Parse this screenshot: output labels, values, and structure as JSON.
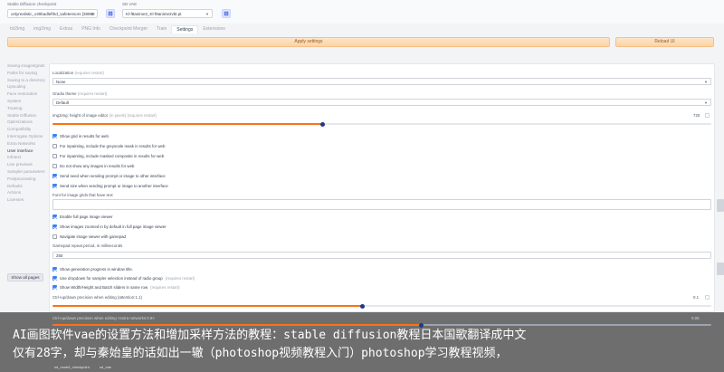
{
  "topbar": {
    "checkpoint_label": "Stable Diffusion checkpoint",
    "checkpoint_value": "onlyrealistic_v30badlefthd_safetensors [39958",
    "clip_label": "SD VAE",
    "clip_value": "Kl-f8anime2_Kl-f8anime2vbt.pt"
  },
  "tabs": [
    "txt2img",
    "img2img",
    "Extras",
    "PNG Info",
    "Checkpoint Merger",
    "Train",
    "Settings",
    "Extensions"
  ],
  "buttons": {
    "apply": "Apply settings",
    "reload": "Reload UI",
    "show_all": "Show all pages"
  },
  "sidebar": [
    "Saving images/grids",
    "Paths for saving",
    "Saving to a directory",
    "Upscaling",
    "Face restoration",
    "System",
    "Training",
    "Stable Diffusion",
    "Optimizations",
    "Compatibility",
    "Interrogate Options",
    "Extra Networks",
    "User interface",
    "Infotext",
    "Live previews",
    "Sampler parameters",
    "Postprocessing",
    "Defaults",
    "Actions",
    "Licenses"
  ],
  "sidebar_active_index": 12,
  "settings": {
    "localization_label": "Localization",
    "localization_note": "(requires restart)",
    "localization_value": "None",
    "gradio_label": "Gradio theme",
    "gradio_note": "(requires restart)",
    "gradio_value": "Default",
    "img_height_label": "img2img: height of image editor",
    "img_height_note": "(in pixels) (requires restart)",
    "img_height_value": "720",
    "img_height_fraction": 0.41,
    "checks1": [
      {
        "text": "Show grid in results for web",
        "note": "",
        "on": true
      },
      {
        "text": "For inpainting, include the greyscale mask in results for web",
        "note": "",
        "on": false
      },
      {
        "text": "For inpainting, include masked composite in results for web",
        "note": "",
        "on": false
      },
      {
        "text": "Do not show any images in results for web",
        "note": "",
        "on": false
      },
      {
        "text": "Send seed when sending prompt or image to other interface",
        "note": "",
        "on": true
      },
      {
        "text": "Send size when sending prompt or image to another interface",
        "note": "",
        "on": true
      }
    ],
    "font_label": "Font for image grids that have text",
    "checks2": [
      {
        "text": "Enable full page image viewer",
        "note": "",
        "on": true
      },
      {
        "text": "Show images zoomed in by default in full page image viewer",
        "note": "",
        "on": true
      },
      {
        "text": "Navigate image viewer with gamepad",
        "note": "",
        "on": false
      }
    ],
    "gamepad_label": "Gamepad repeat period, in milliseconds",
    "gamepad_value": "250",
    "checks3": [
      {
        "text": "Show generation progress in window title.",
        "note": "",
        "on": true
      },
      {
        "text": "Use dropdown for sampler selection instead of radio group",
        "note": "(requires restart)",
        "on": true
      },
      {
        "text": "Show Width/Height and Batch sliders in same row",
        "note": "(requires restart)",
        "on": true
      }
    ],
    "ctrl_label": "Ctrl+up/down precision when editing (attention:1.1)",
    "ctrl_value": "0.1",
    "ctrl_fraction": 0.47,
    "ctrl2_label": "Ctrl+up/down precision when editing <extra networks:0.9>",
    "ctrl2_value": "0.05",
    "ctrl2_fraction": 0.56
  },
  "overlay": {
    "line1": "AI画图软件vae的设置方法和增加采样方法的教程：stable diffusion教程日本国歌翻译成中文",
    "line2": "仅有28字，却与秦始皇的话如出一辙（photoshop视频教程入门）photoshop学习教程视频，",
    "mini_left": "sd_model_checkpoint",
    "mini_right": "sd_vae"
  }
}
